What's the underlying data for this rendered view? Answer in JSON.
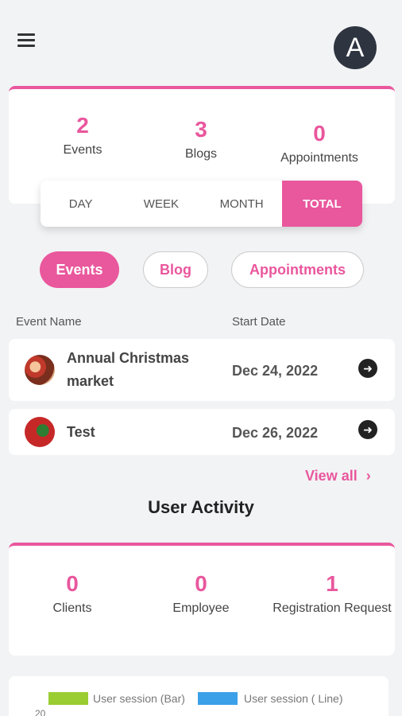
{
  "header": {
    "avatar_letter": "A"
  },
  "summary": {
    "stats": [
      {
        "value": "2",
        "label": "Events"
      },
      {
        "value": "3",
        "label": "Blogs"
      },
      {
        "value": "0",
        "label": "Appointments"
      }
    ],
    "periods": [
      "DAY",
      "WEEK",
      "MONTH",
      "TOTAL"
    ],
    "active_period": "TOTAL"
  },
  "filters": {
    "items": [
      "Events",
      "Blog",
      "Appointments"
    ],
    "active": "Events"
  },
  "table": {
    "headers": {
      "name": "Event Name",
      "date": "Start Date"
    },
    "rows": [
      {
        "name_line1": "Annual Christmas",
        "name_line2": "market",
        "date": "Dec 24, 2022"
      },
      {
        "name_line1": "Test",
        "name_line2": "",
        "date": "Dec 26, 2022"
      }
    ],
    "view_all": "View all"
  },
  "user_activity": {
    "title": "User Activity",
    "stats": [
      {
        "value": "0",
        "label": "Clients"
      },
      {
        "value": "0",
        "label": "Employee"
      },
      {
        "value": "1",
        "label": "Registration Request"
      }
    ]
  },
  "chart_legend": {
    "items": [
      {
        "label": "User session (Bar)",
        "color": "#9acd32"
      },
      {
        "label": "User session ( Line)",
        "color": "#3aa0e8"
      }
    ],
    "first_tick": "20"
  },
  "colors": {
    "accent": "#e9579d",
    "dark": "#2e3440"
  }
}
